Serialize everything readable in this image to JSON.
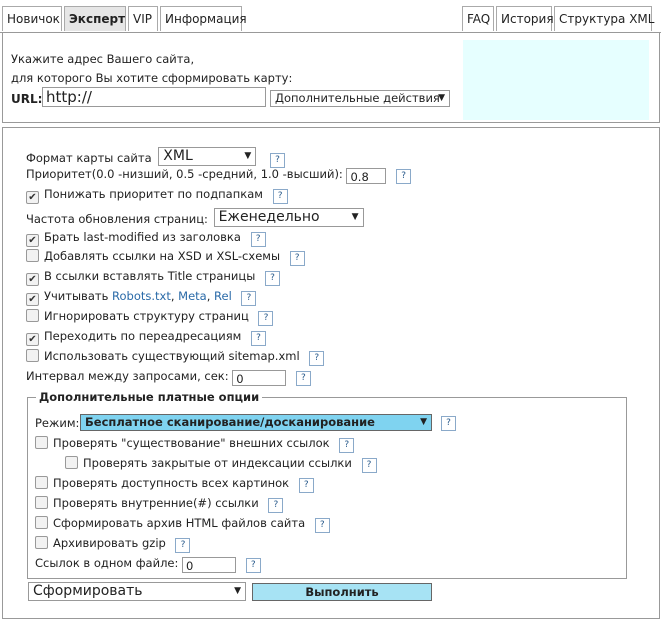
{
  "tabs_left": [
    "Новичок",
    "Эксперт",
    "VIP",
    "Информация"
  ],
  "tabs_right": [
    "FAQ",
    "История",
    "Структура XML"
  ],
  "intro": {
    "line1": "Укажите адрес Вашего сайта,",
    "line2": "для которого Вы хотите сформировать карту:",
    "url_label": "URL:",
    "url_value": "http://",
    "extra_actions": "Дополнительные действия"
  },
  "settings": {
    "format_label": "Формат карты сайта",
    "format_value": "XML",
    "priority_label": "Приоритет(0.0 -низший, 0.5 -средний, 1.0 -высший):",
    "priority_value": "0.8",
    "lower_priority": "Понижать приоритет по подпапкам",
    "freq_label": "Частота обновления страниц:",
    "freq_value": "Еженедельно",
    "last_modified": "Брать last-modified из заголовка",
    "xsd_links": "Добавлять ссылки на XSD и XSL-схемы",
    "title_links": "В ссылки вставлять Title страницы",
    "consider_prefix": "Учитывать",
    "consider_robots": "Robots.txt",
    "consider_meta": "Meta",
    "consider_rel": "Rel",
    "ignore_structure": "Игнорировать структуру страниц",
    "follow_redirects": "Переходить по переадресациям",
    "use_sitemap": "Использовать существующий sitemap.xml",
    "interval_label": "Интервал между запросами, сек:",
    "interval_value": "0"
  },
  "paid": {
    "legend": "Дополнительные платные опции",
    "mode_label": "Режим:",
    "mode_value": "Бесплатное сканирование/досканирование",
    "check_external": "Проверять \"существование\" внешних ссылок",
    "check_closed": "Проверять закрытые от индексации ссылки",
    "check_images": "Проверять доступность всех картинок",
    "check_internal": "Проверять внутренние(#) ссылки",
    "archive_html": "Сформировать архив HTML файлов сайта",
    "archive_gzip": "Архивировать gzip",
    "links_label": "Ссылок в одном файле:",
    "links_value": "0"
  },
  "action": {
    "select_value": "Сформировать",
    "run_label": "Выполнить"
  },
  "help_glyph": "?"
}
